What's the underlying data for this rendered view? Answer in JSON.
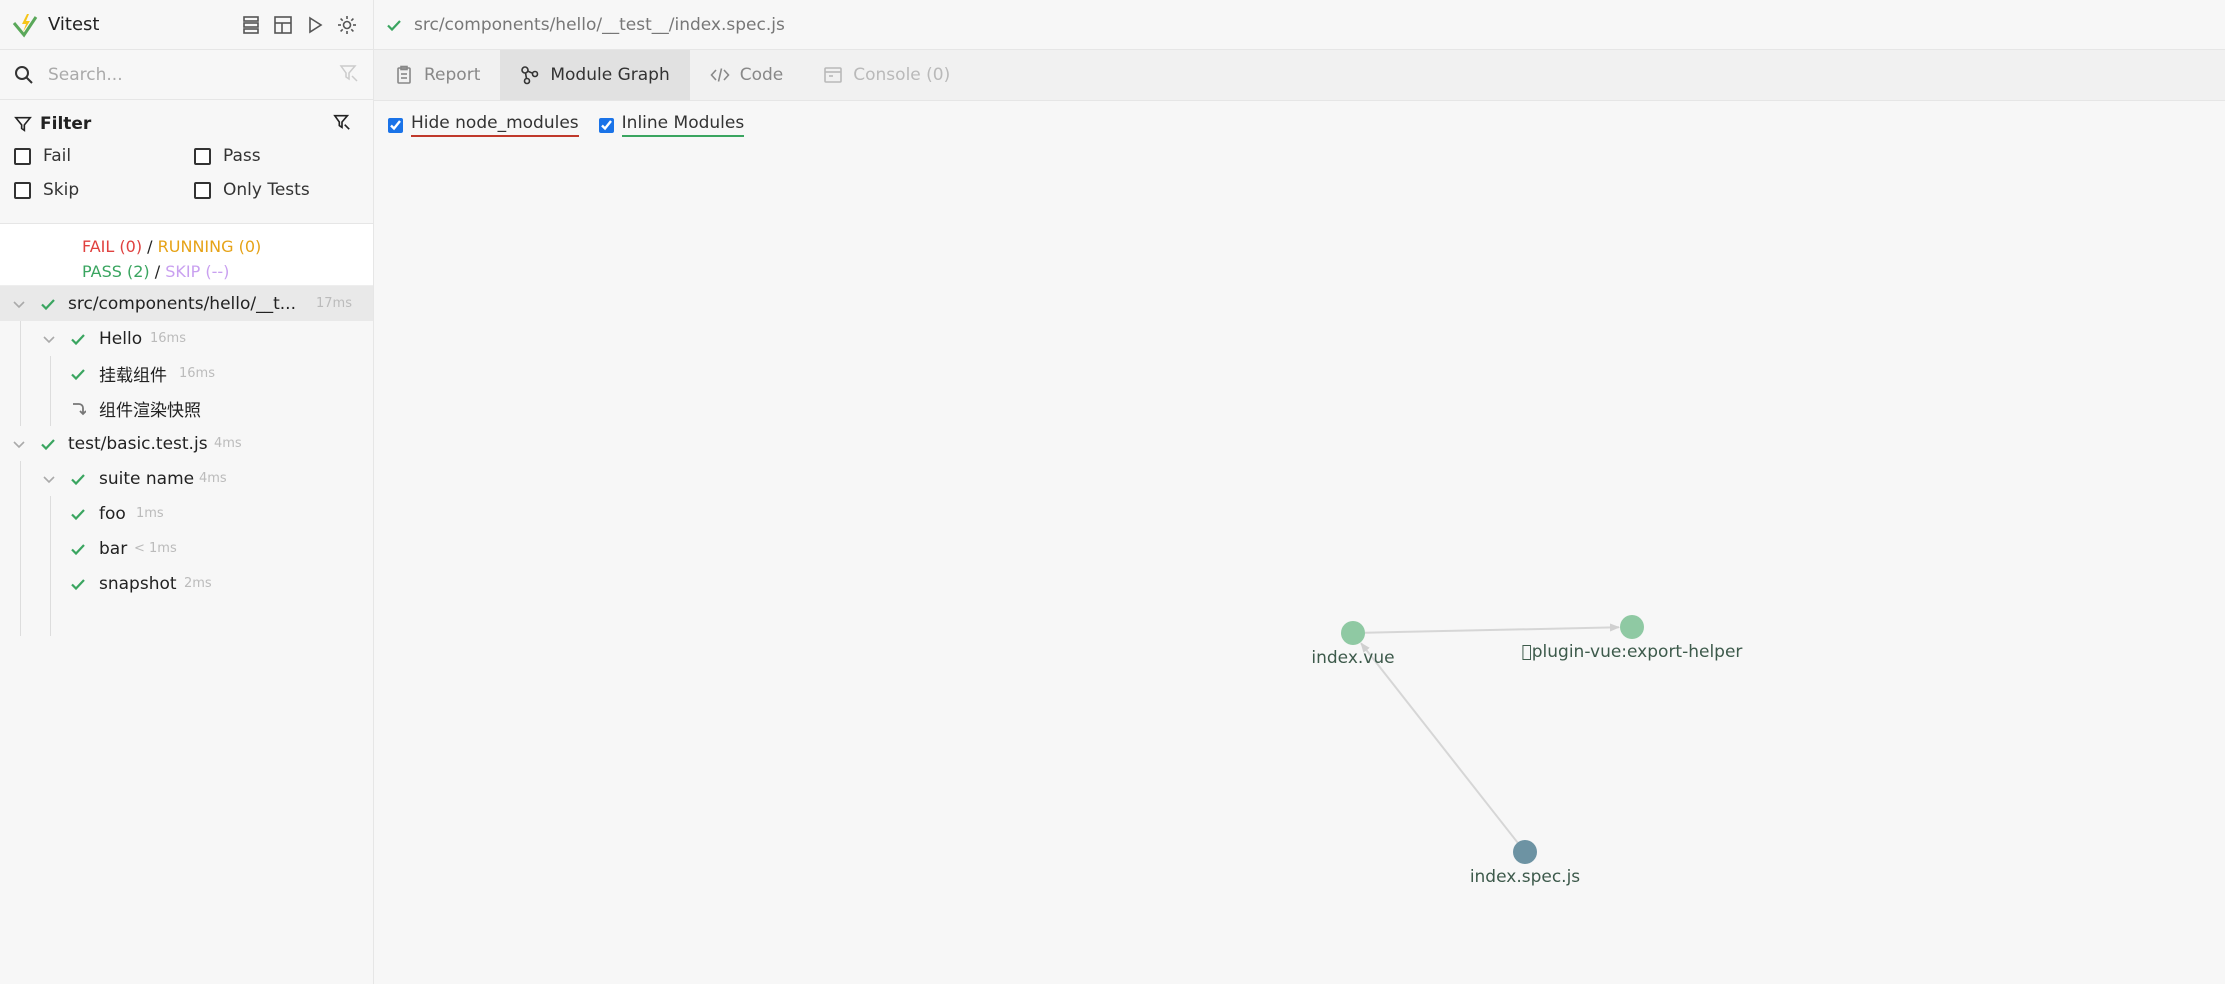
{
  "app": {
    "title": "Vitest"
  },
  "search": {
    "placeholder": "Search..."
  },
  "filter": {
    "label": "Filter",
    "options": {
      "fail": "Fail",
      "pass": "Pass",
      "skip": "Skip",
      "only_tests": "Only Tests"
    }
  },
  "summary": {
    "fail": "FAIL (0)",
    "running": "RUNNING (0)",
    "pass": "PASS (2)",
    "skip": "SKIP (--)",
    "sep": "/"
  },
  "tree": [
    {
      "name": "src/components/hello/__t...",
      "duration": "17ms",
      "status": "pass"
    },
    {
      "name": "Hello",
      "duration": "16ms",
      "status": "pass"
    },
    {
      "name": "挂载组件",
      "duration": "16ms",
      "status": "pass"
    },
    {
      "name": "组件渲染快照",
      "duration": "",
      "status": "snapshot"
    },
    {
      "name": "test/basic.test.js",
      "duration": "4ms",
      "status": "pass"
    },
    {
      "name": "suite name",
      "duration": "4ms",
      "status": "pass"
    },
    {
      "name": "foo",
      "duration": "1ms",
      "status": "pass"
    },
    {
      "name": "bar",
      "duration": "< 1ms",
      "status": "pass"
    },
    {
      "name": "snapshot",
      "duration": "2ms",
      "status": "pass"
    }
  ],
  "header": {
    "path": "src/components/hello/__test__/index.spec.js"
  },
  "tabs": {
    "report": "Report",
    "module_graph": "Module Graph",
    "code": "Code",
    "console": "Console (0)"
  },
  "graph": {
    "options": {
      "hide_node_modules": "Hide node_modules",
      "inline_modules": "Inline Modules"
    },
    "nodes": [
      {
        "id": "index.vue",
        "label": "index.vue",
        "color": "#8fc9a3"
      },
      {
        "id": "helper",
        "label": "\u0000plugin-vue:export-helper",
        "color": "#8fc9a3"
      },
      {
        "id": "spec",
        "label": "index.spec.js",
        "color": "#6d93a3"
      }
    ],
    "edges": [
      {
        "from": "index.vue",
        "to": "helper"
      },
      {
        "from": "spec",
        "to": "index.vue"
      }
    ]
  },
  "colors": {
    "pass": "#3aa560",
    "fail": "#e0413f",
    "running": "#e6a317",
    "skip": "#c9a0f0",
    "node_green": "#8fc9a3",
    "node_blue": "#6d93a3"
  }
}
